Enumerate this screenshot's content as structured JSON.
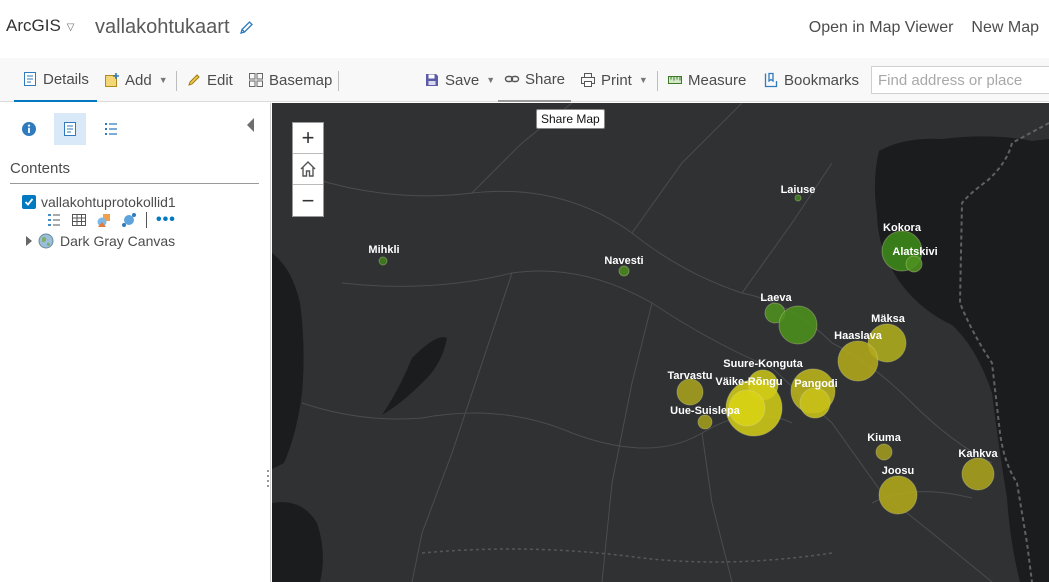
{
  "header": {
    "brand": "ArcGIS",
    "map_title": "vallakohtukaart",
    "open_in_map_viewer": "Open in Map Viewer",
    "new_map": "New Map"
  },
  "toolbar": {
    "details": "Details",
    "add": "Add",
    "edit": "Edit",
    "basemap": "Basemap",
    "save": "Save",
    "share": "Share",
    "print": "Print",
    "measure": "Measure",
    "bookmarks": "Bookmarks",
    "search_placeholder": "Find address or place"
  },
  "tooltip": "Share Map",
  "panel": {
    "contents_label": "Contents",
    "layers": [
      {
        "name": "vallakohtuprotokollid1",
        "checked": true
      },
      {
        "name": "Dark Gray Canvas"
      }
    ]
  },
  "map": {
    "zoom_in": "+",
    "zoom_out": "−",
    "places": [
      {
        "name": "Laiuse",
        "size": 3,
        "color": "#3f7f1e"
      },
      {
        "name": "Mihkli",
        "size": 4,
        "color": "#3f7f1e"
      },
      {
        "name": "Navesti",
        "size": 5,
        "color": "#4a8a1e"
      },
      {
        "name": "Kokora",
        "size": 20,
        "color": "#3d8a1a"
      },
      {
        "name": "Alatskivi",
        "size": 8,
        "color": "#4d9220"
      },
      {
        "name": "Laeva",
        "size": 10,
        "color": "#4f9120"
      },
      {
        "name": "",
        "size": 19,
        "color": "#4c911c"
      },
      {
        "name": "Mäksa",
        "size": 19,
        "color": "#b0ad1c"
      },
      {
        "name": "Haaslava",
        "size": 20,
        "color": "#b3a81a"
      },
      {
        "name": "Suure-Konguta",
        "size": 15,
        "color": "#c6c118"
      },
      {
        "name": "Väike-Rõngu",
        "size": 28,
        "color": "#d1cb16"
      },
      {
        "name": "Pangodi",
        "size": 22,
        "color": "#bdb51a"
      },
      {
        "name": "",
        "size": 15,
        "color": "#c9c118"
      },
      {
        "name": "Tarvastu",
        "size": 13,
        "color": "#a8a01c"
      },
      {
        "name": "Uue-Suislepa",
        "size": 7,
        "color": "#a39d1c"
      },
      {
        "name": "",
        "size": 18,
        "color": "#d9d314"
      },
      {
        "name": "Kiuma",
        "size": 8,
        "color": "#a39a1c"
      },
      {
        "name": "Kahkva",
        "size": 16,
        "color": "#aba21c"
      },
      {
        "name": "Joosu",
        "size": 19,
        "color": "#b2a91a"
      }
    ]
  }
}
